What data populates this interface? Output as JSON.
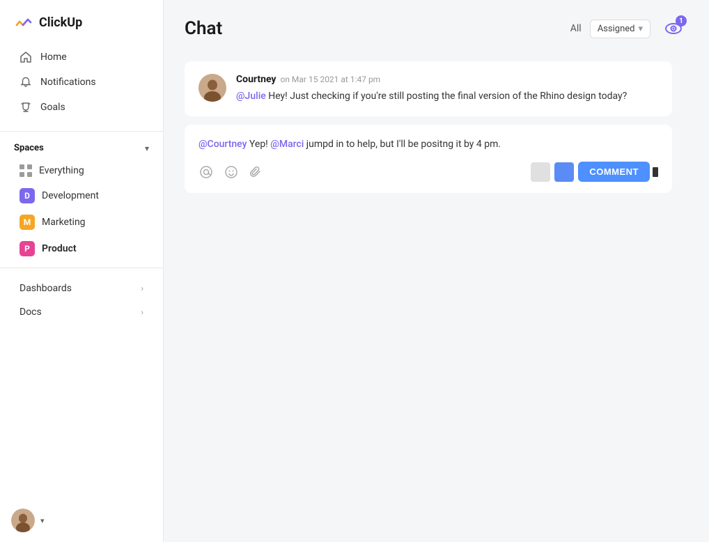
{
  "app": {
    "logo_text": "ClickUp"
  },
  "sidebar": {
    "nav": [
      {
        "id": "home",
        "label": "Home",
        "icon": "home"
      },
      {
        "id": "notifications",
        "label": "Notifications",
        "icon": "bell"
      },
      {
        "id": "goals",
        "label": "Goals",
        "icon": "trophy"
      }
    ],
    "spaces_label": "Spaces",
    "spaces": [
      {
        "id": "everything",
        "label": "Everything",
        "type": "dots"
      },
      {
        "id": "development",
        "label": "Development",
        "badge": "D",
        "color": "dev"
      },
      {
        "id": "marketing",
        "label": "Marketing",
        "badge": "M",
        "color": "mkt"
      },
      {
        "id": "product",
        "label": "Product",
        "badge": "P",
        "color": "prod",
        "active": true
      }
    ],
    "sections": [
      {
        "id": "dashboards",
        "label": "Dashboards"
      },
      {
        "id": "docs",
        "label": "Docs"
      }
    ]
  },
  "header": {
    "title": "Chat",
    "filter_all": "All",
    "filter_assigned": "Assigned",
    "watch_count": "1"
  },
  "messages": [
    {
      "id": "msg1",
      "author": "Courtney",
      "timestamp": "on Mar 15 2021 at 1:47 pm",
      "mention": "@Julie",
      "text": " Hey! Just checking if you're still posting the final version of the Rhino design today?"
    }
  ],
  "reply": {
    "mention1": "@Courtney",
    "text1": " Yep! ",
    "mention2": "@Marci",
    "text2": " jumpd in to help, but I'll be positng it by 4 pm.",
    "comment_label": "COMMENT"
  }
}
